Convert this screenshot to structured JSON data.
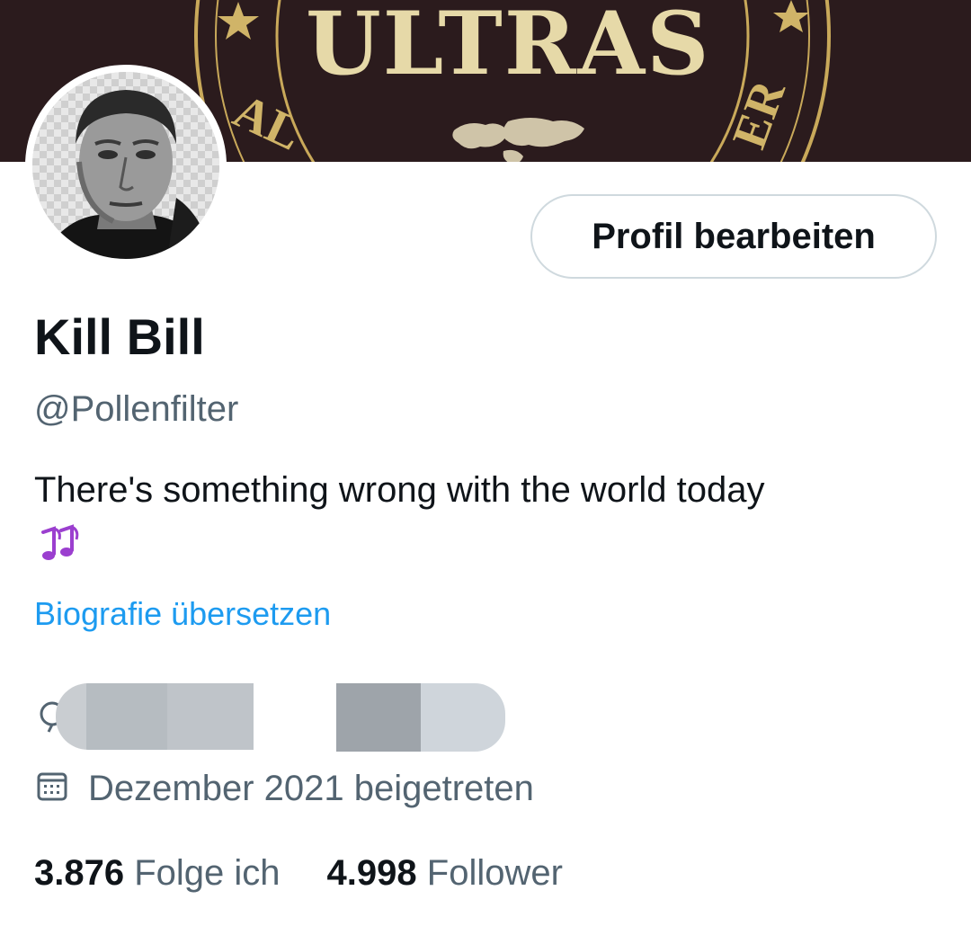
{
  "banner": {
    "text": "ULTRAS",
    "bg_color": "#2a1a1c",
    "accent_color": "#d9c27a"
  },
  "profile": {
    "edit_button_label": "Profil bearbeiten",
    "display_name": "Kill Bill",
    "handle": "@Pollenfilter",
    "bio_text": "There's something wrong with the world today",
    "bio_emoji": "🎶",
    "translate_link": "Biografie übersetzen",
    "location_icon": "location-pin-icon",
    "joined_icon": "calendar-icon",
    "joined_text": "Dezember 2021 beigetreten"
  },
  "stats": {
    "following_count": "3.876",
    "following_label": "Folge ich",
    "followers_count": "4.998",
    "followers_label": "Follower"
  },
  "colors": {
    "link": "#1d9bf0",
    "secondary_text": "#536471",
    "primary_text": "#0f1419",
    "border": "#cfd9de"
  }
}
